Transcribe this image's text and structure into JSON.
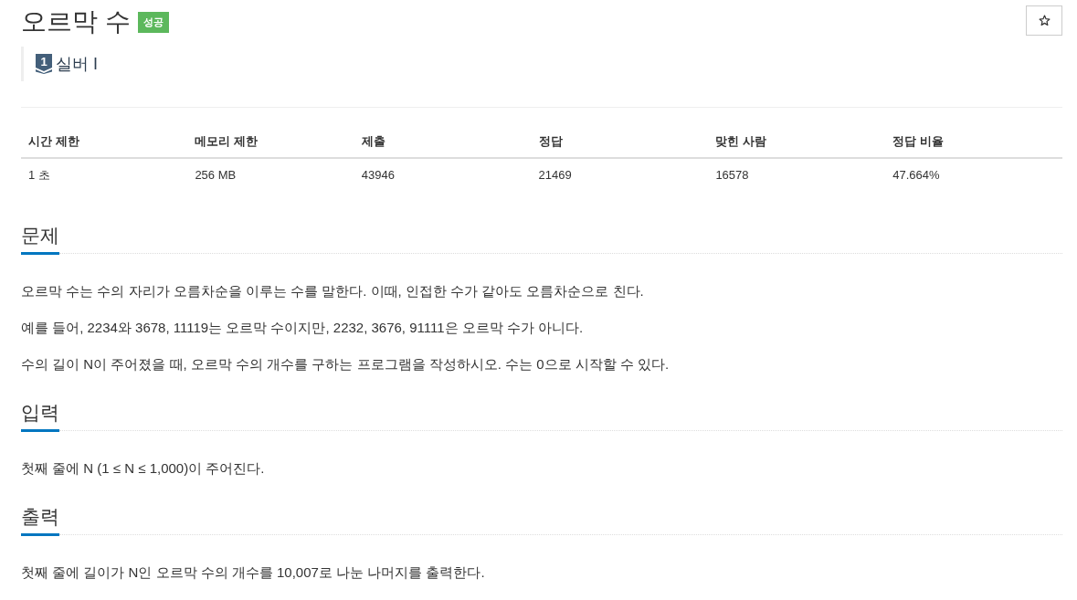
{
  "problem": {
    "title": "오르막 수",
    "result_badge": "성공",
    "starred": false
  },
  "tier": {
    "icon_number": "1",
    "name": "실버 I"
  },
  "stats_table": {
    "columns": [
      "시간 제한",
      "메모리 제한",
      "제출",
      "정답",
      "맞힌 사람",
      "정답 비율"
    ],
    "rows": [
      [
        "1 초",
        "256 MB",
        "43946",
        "21469",
        "16578",
        "47.664%"
      ]
    ]
  },
  "sections": [
    {
      "heading": "문제",
      "paragraphs": [
        "오르막 수는 수의 자리가 오름차순을 이루는 수를 말한다. 이때, 인접한 수가 같아도 오름차순으로 친다.",
        "예를 들어, 2234와 3678, 11119는 오르막 수이지만, 2232, 3676, 91111은 오르막 수가 아니다.",
        "수의 길이 N이 주어졌을 때, 오르막 수의 개수를 구하는 프로그램을 작성하시오. 수는 0으로 시작할 수 있다."
      ]
    },
    {
      "heading": "입력",
      "paragraphs": [
        "첫째 줄에 N (1 ≤ N ≤ 1,000)이 주어진다."
      ]
    },
    {
      "heading": "출력",
      "paragraphs": [
        "첫째 줄에 길이가 N인 오르막 수의 개수를 10,007로 나눈 나머지를 출력한다."
      ]
    }
  ]
}
